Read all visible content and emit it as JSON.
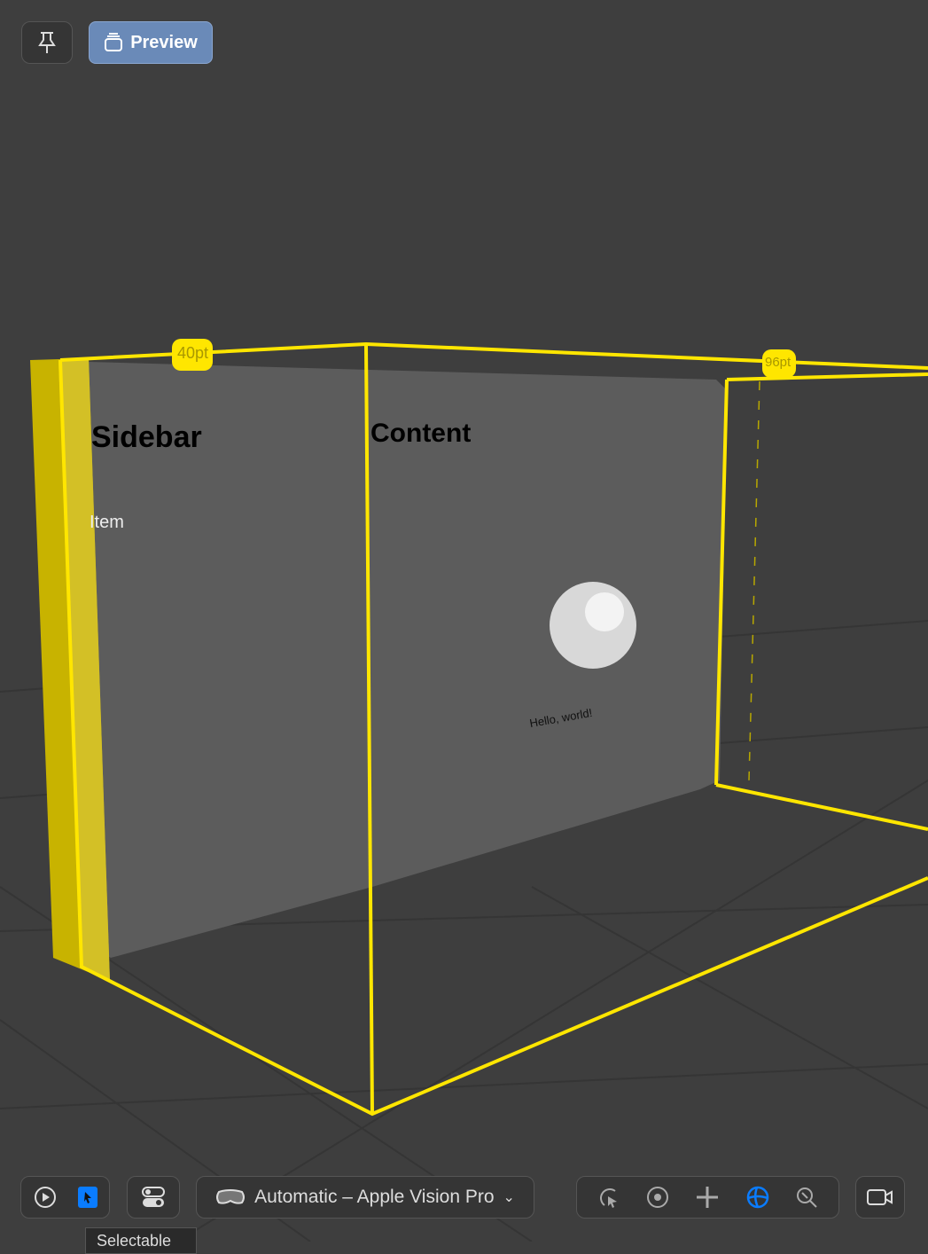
{
  "toolbar_top": {
    "pin_icon": "pin-icon",
    "preview_label": "Preview"
  },
  "scene": {
    "sidebar_title": "Sidebar",
    "sidebar_item": "Item",
    "content_title": "Content",
    "content_text": "Hello, world!",
    "dimension_left": "40pt",
    "dimension_right": "96pt",
    "highlight_color": "#ffe600"
  },
  "toolbar_bottom": {
    "play_icon": "play-circle-icon",
    "select_icon": "cursor-select-icon",
    "toggles_icon": "toggles-icon",
    "device_label": "Automatic – Apple Vision Pro",
    "tools": [
      "rotate-cursor-icon",
      "orbit-icon",
      "pan-icon",
      "globe-icon",
      "zoom-icon"
    ],
    "active_tool": "globe-icon",
    "camera_icon": "video-camera-icon",
    "tooltip": "Selectable"
  }
}
